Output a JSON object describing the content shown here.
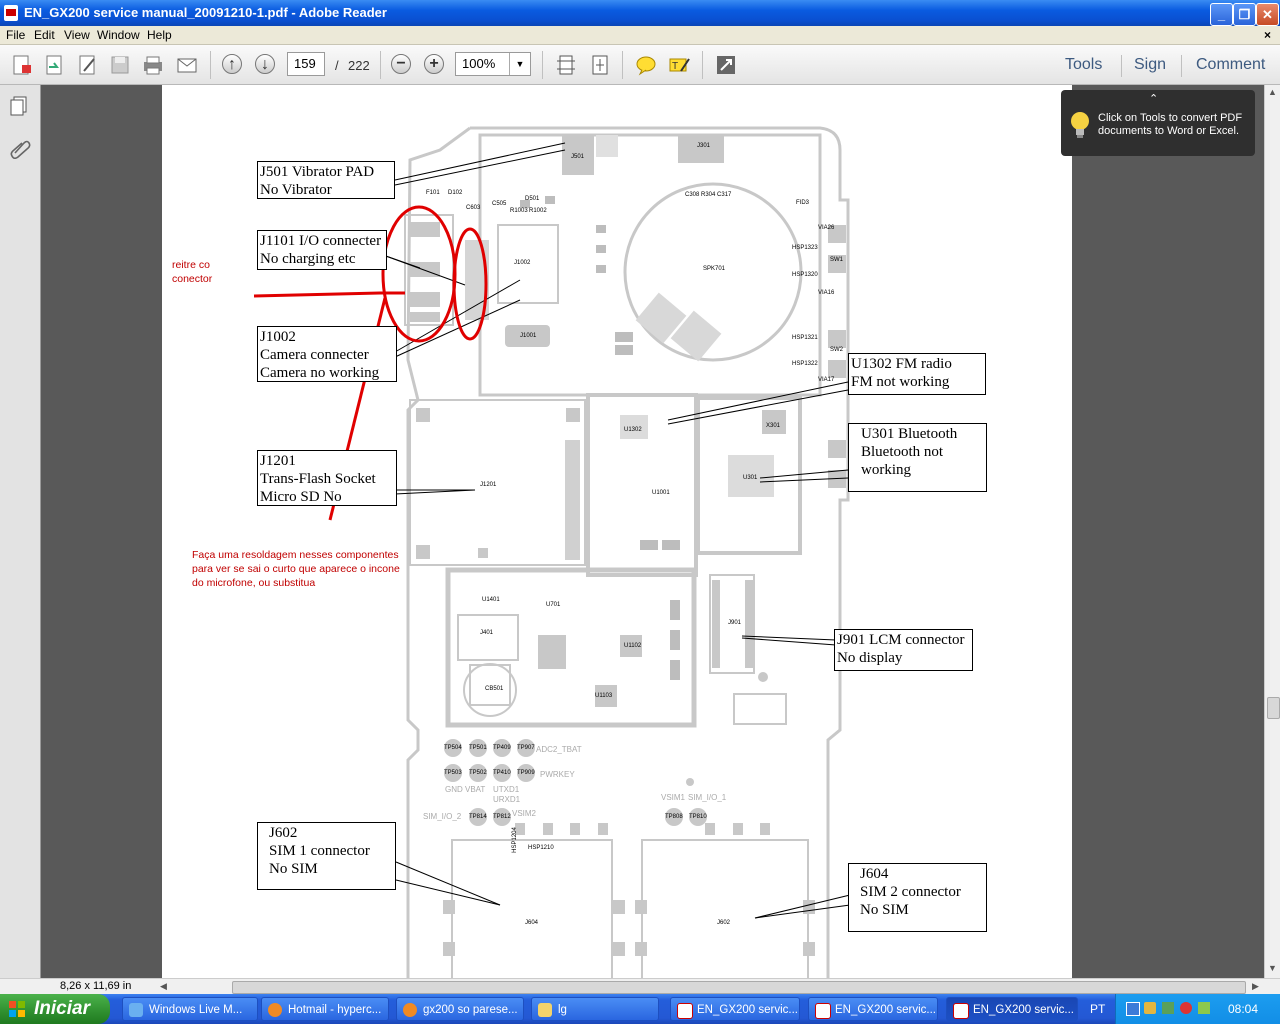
{
  "window": {
    "title": "EN_GX200 service manual_20091210-1.pdf - Adobe Reader"
  },
  "menu": [
    "File",
    "Edit",
    "View",
    "Window",
    "Help"
  ],
  "toolbar": {
    "page_current": "159",
    "page_total": "222",
    "page_sep": "/",
    "zoom": "100%",
    "tools": "Tools",
    "sign": "Sign",
    "comment": "Comment"
  },
  "tooltip": {
    "text": "Click on Tools to convert PDF documents to Word or Excel."
  },
  "status": {
    "page_size": "8,26 x 11,69 in"
  },
  "doc": {
    "callouts": [
      "J501 Vibrator PAD\nNo Vibrator",
      "J1101 I/O connecter\nNo charging etc",
      "J1002\nCamera connecter\nCamera no working",
      "J1201\nTrans-Flash Socket\nMicro SD No",
      "U1302 FM radio\nFM not working",
      "U301 Bluetooth\nBluetooth not\nworking",
      "J901 LCM connector\nNo display",
      "J602\nSIM 1 connector\nNo SIM",
      "J604\nSIM 2 connector\nNo SIM"
    ],
    "notes": [
      "reitre co\nconector",
      "Faça uma resoldagem nesses componentes\npara ver se sai o curto que aparece o incone\ndo microfone, ou substitua"
    ],
    "labels": [
      "J501",
      "J301",
      "SPK701",
      "J1201",
      "J1002",
      "J1001",
      "U1302",
      "X301",
      "U301",
      "J901",
      "J401",
      "CB501",
      "U1001",
      "U1102",
      "U1103",
      "J604",
      "J602",
      "U1401",
      "U701",
      "C603",
      "C505",
      "D501",
      "R1003",
      "R1002",
      "F101",
      "D102",
      "C308 R304 C317",
      "FID3",
      "VIA26",
      "HSP1323",
      "SW1",
      "HSP1320",
      "VIA16",
      "HSP1321",
      "SW2",
      "HSP1322",
      "VIA17",
      "TP504",
      "TP501",
      "TP409",
      "TP907",
      "ADC2_TBAT",
      "TP503",
      "TP502",
      "TP410",
      "TP909",
      "PWRKEY",
      "GND VBAT",
      "UTXD1",
      "URXD1",
      "SIM_I/O_2",
      "TP814",
      "TP812",
      "VSIM2",
      "VSIM1",
      "SIM_I/O_1",
      "TP808",
      "TP810",
      "HSP1210",
      "HSP1204"
    ]
  },
  "taskbar": {
    "start": "Iniciar",
    "tasks": [
      "Windows Live M...",
      "Hotmail - hyperc...",
      "gx200 so parese...",
      "lg",
      "EN_GX200 servic...",
      "EN_GX200 servic...",
      "EN_GX200 servic..."
    ],
    "lang": "PT",
    "clock": "08:04"
  },
  "colors": {
    "titlebar": "#0a5be0",
    "annotation_red": "#e00000",
    "pcb_gray": "#c8c8c8",
    "taskbar": "#245edb",
    "start": "#2f8f2f"
  }
}
